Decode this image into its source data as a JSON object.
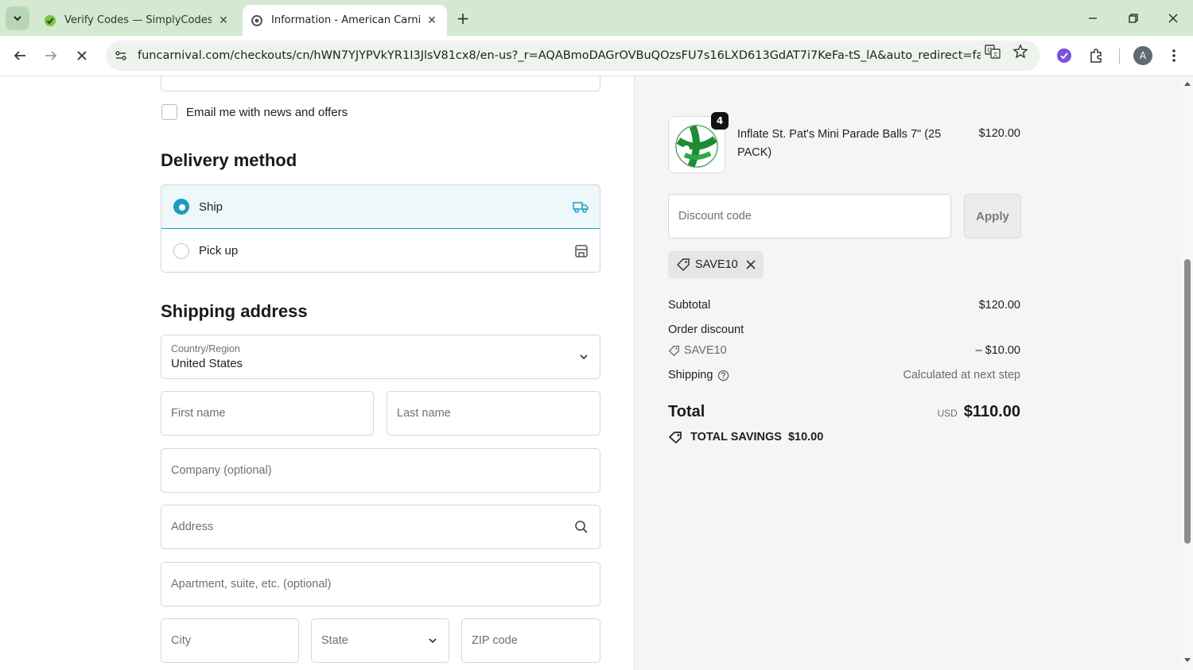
{
  "browser": {
    "tabs": [
      {
        "title": "Verify Codes — SimplyCodes",
        "active": false
      },
      {
        "title": "Information - American Carniva",
        "active": true
      }
    ],
    "url": "funcarnival.com/checkouts/cn/hWN7YJYPVkYR1I3JlsV81cx8/en-us?_r=AQABmoDAGrOVBuQOzsFU7s16LXD613GdAT7i7KeFa-tS_lA&auto_redirect=false&e...",
    "avatar_letter": "A",
    "loading": true
  },
  "contact": {
    "email_opt_in_label": "Email me with news and offers",
    "email_opt_in_checked": false
  },
  "delivery": {
    "heading": "Delivery method",
    "options": [
      {
        "label": "Ship",
        "selected": true,
        "icon": "truck-icon"
      },
      {
        "label": "Pick up",
        "selected": false,
        "icon": "store-icon"
      }
    ]
  },
  "shipping": {
    "heading": "Shipping address",
    "country_label": "Country/Region",
    "country_value": "United States",
    "first_name_placeholder": "First name",
    "last_name_placeholder": "Last name",
    "company_placeholder": "Company (optional)",
    "address_placeholder": "Address",
    "apartment_placeholder": "Apartment, suite, etc. (optional)",
    "city_placeholder": "City",
    "state_placeholder": "State",
    "zip_placeholder": "ZIP code"
  },
  "summary": {
    "product": {
      "name": "Inflate St. Pat's Mini Parade Balls 7\" (25 PACK)",
      "price": "$120.00",
      "quantity": "4"
    },
    "discount_placeholder": "Discount code",
    "apply_label": "Apply",
    "applied_code": "SAVE10",
    "subtotal_label": "Subtotal",
    "subtotal_value": "$120.00",
    "order_discount_label": "Order discount",
    "discount_code_line": "SAVE10",
    "discount_value": "– $10.00",
    "shipping_label": "Shipping",
    "shipping_value": "Calculated at next step",
    "total_label": "Total",
    "total_currency": "USD",
    "total_value": "$110.00",
    "savings_label": "TOTAL SAVINGS",
    "savings_value": "$10.00"
  },
  "colors": {
    "accent": "#1b9cc2",
    "tabbar_bg": "#d4e8d2",
    "summary_bg": "#f5f5f5"
  }
}
